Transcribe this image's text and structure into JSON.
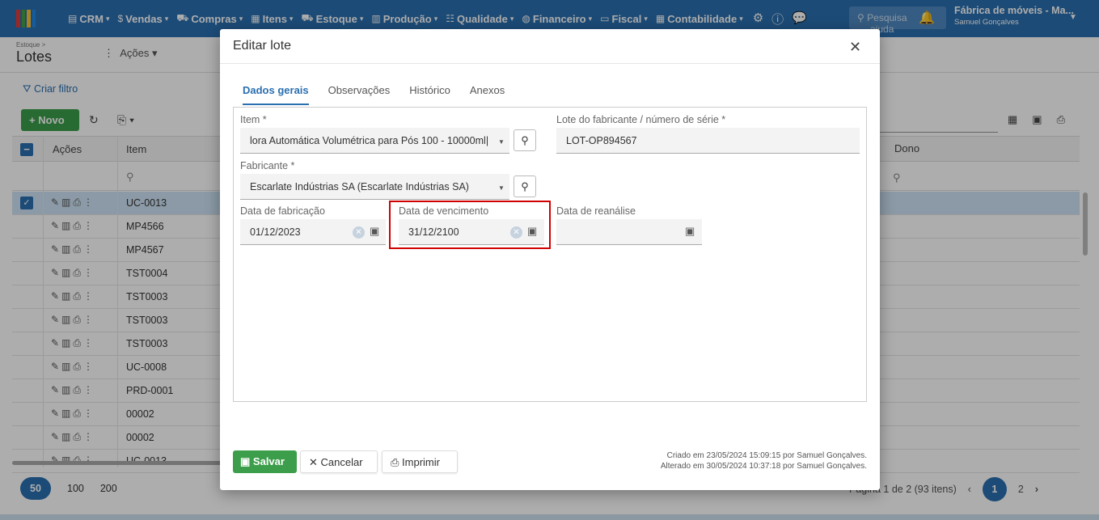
{
  "topnav": {
    "items": [
      {
        "label": "CRM",
        "icon": "chart-icon"
      },
      {
        "label": "Vendas",
        "icon": "dollar-icon"
      },
      {
        "label": "Compras",
        "icon": "cart-icon"
      },
      {
        "label": "Itens",
        "icon": "items-icon"
      },
      {
        "label": "Estoque",
        "icon": "dolly-icon"
      },
      {
        "label": "Produção",
        "icon": "factory-icon"
      },
      {
        "label": "Qualidade",
        "icon": "checklist-icon"
      },
      {
        "label": "Financeiro",
        "icon": "money-bag-icon"
      },
      {
        "label": "Fiscal",
        "icon": "document-icon"
      },
      {
        "label": "Contabilidade",
        "icon": "calculator-icon"
      }
    ],
    "search_placeholder": "Pesquisa",
    "help_text": "ajuda",
    "company": "Fábrica de móveis - Ma...",
    "user": "Samuel Gonçalves"
  },
  "page": {
    "breadcrumb": "Estoque >",
    "title": "Lotes",
    "actions_label": "Ações",
    "create_filter": "Criar filtro",
    "new_button": "Novo"
  },
  "grid": {
    "columns": {
      "actions": "Ações",
      "item": "Item",
      "owner": "Dono"
    },
    "rows": [
      "UC-0013",
      "MP4566",
      "MP4567",
      "TST0004",
      "TST0003",
      "TST0003",
      "TST0003",
      "UC-0008",
      "PRD-0001",
      "00002",
      "00002",
      "UC-0013"
    ],
    "page_sizes": [
      "50",
      "100",
      "200"
    ],
    "pagination_info": "Página 1 de 2 (93 itens)",
    "pages": [
      "1",
      "2"
    ]
  },
  "modal": {
    "title": "Editar lote",
    "tabs": [
      "Dados gerais",
      "Observações",
      "Histórico",
      "Anexos"
    ],
    "fields": {
      "item_label": "Item *",
      "item_value": "lora Automática Volumétrica para Pós 100 - 10000ml",
      "lot_label": "Lote do fabricante / número de série *",
      "lot_value": "LOT-OP894567",
      "manufacturer_label": "Fabricante *",
      "manufacturer_value": "Escarlate Indústrias SA (Escarlate Indústrias SA)",
      "manufacture_date_label": "Data de fabricação",
      "manufacture_date_value": "01/12/2023",
      "expiry_date_label": "Data de vencimento",
      "expiry_date_value": "31/12/2100",
      "reanalysis_date_label": "Data de reanálise",
      "reanalysis_date_value": ""
    },
    "buttons": {
      "save": "Salvar",
      "cancel": "Cancelar",
      "print": "Imprimir"
    },
    "audit": {
      "created": "Criado em 23/05/2024 15:09:15 por Samuel Gonçalves.",
      "modified": "Alterado em 30/05/2024 10:37:18 por Samuel Gonçalves."
    }
  },
  "colors": {
    "primary": "#2a6fb0",
    "success": "#3c9e4a",
    "highlight": "#d10000"
  }
}
